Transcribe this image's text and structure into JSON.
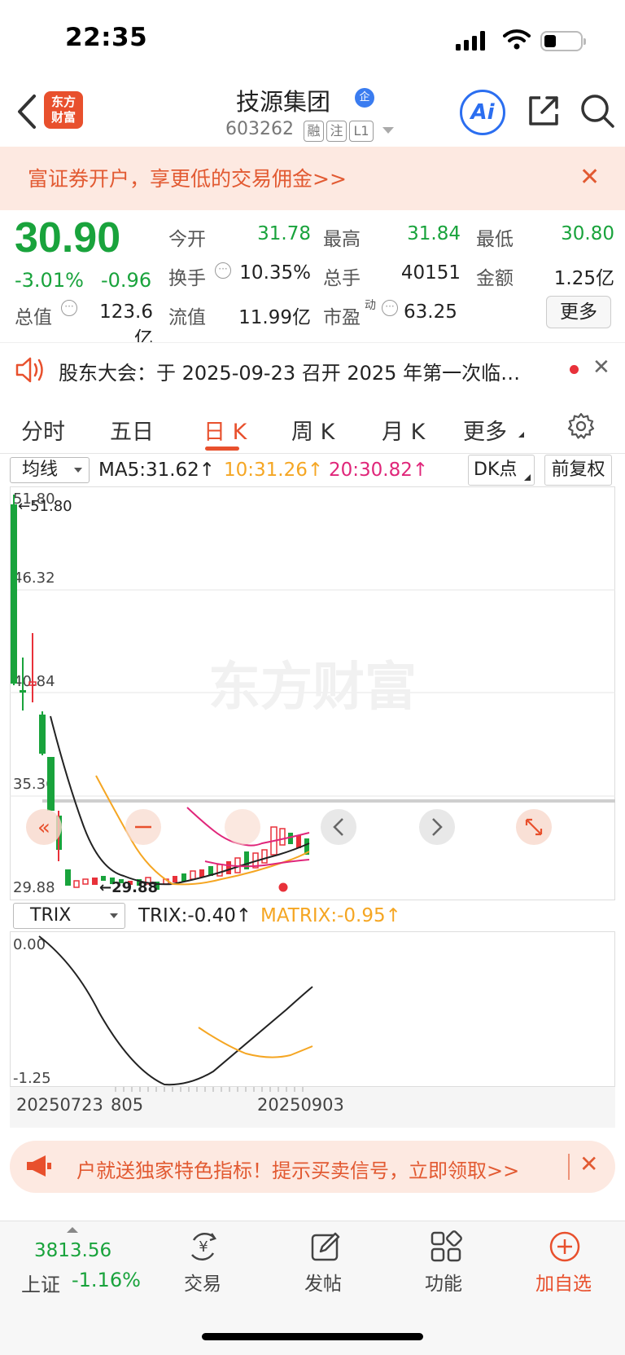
{
  "status": {
    "time": "22:35"
  },
  "header": {
    "logo_line1": "东方",
    "logo_line2": "财富",
    "stock_name": "技源集团",
    "verified": "企",
    "stock_code": "603262",
    "tags": [
      "融",
      "注",
      "L1"
    ],
    "ai_label": "Ai"
  },
  "promo": {
    "text": "富证券开户，享更低的交易佣金>>"
  },
  "quote": {
    "price": "30.90",
    "change_pct": "-3.01%",
    "change_amt": "-0.96",
    "open_label": "今开",
    "open": "31.78",
    "high_label": "最高",
    "high": "31.84",
    "low_label": "最低",
    "low": "30.80",
    "turnover_label": "换手",
    "turnover": "10.35%",
    "volume_label": "总手",
    "volume": "40151",
    "amount_label": "金额",
    "amount": "1.25亿",
    "mktcap_label": "总值",
    "mktcap": "123.6亿",
    "float_label": "流值",
    "float": "11.99亿",
    "pe_label": "市盈",
    "pe_sup": "动",
    "pe": "63.25",
    "more_label": "更多"
  },
  "announcement": {
    "text": "股东大会：于 2025-09-23 召开 2025 年第一次临…"
  },
  "tabs": [
    "分时",
    "五日",
    "日 K",
    "周 K",
    "月 K",
    "更多"
  ],
  "indicators": {
    "ma_select": "均线",
    "ma5": "MA5:31.62↑",
    "ma10": "10:31.26↑",
    "ma20": "20:30.82↑",
    "dk": "DK点",
    "adjust": "前复权",
    "trix_select": "TRIX",
    "trix": "TRIX:-0.40↑",
    "matrix": "MATRIX:-0.95↑"
  },
  "chart_data": [
    {
      "type": "candlestick",
      "y_ticks": [
        "51.80",
        "46.32",
        "40.84",
        "35.36",
        "29.88"
      ],
      "ylim": [
        29.88,
        51.8
      ],
      "high_marker": "←51.80",
      "low_marker": "←29.88",
      "watermark": "东方财富"
    },
    {
      "type": "line",
      "y_ticks": [
        "0.00",
        "-1.25"
      ],
      "ylim": [
        -1.25,
        0.0
      ],
      "x_labels": [
        "20250723",
        "805",
        "20250903"
      ]
    }
  ],
  "promo2": {
    "text": "户就送独家特色指标！提示买卖信号，立即领取>>"
  },
  "bottom": {
    "index_value": "3813.56",
    "index_name": "上证",
    "index_change": "-1.16%",
    "items": [
      "交易",
      "发帖",
      "功能",
      "加自选"
    ]
  },
  "colors": {
    "up": "#e8313a",
    "down": "#19a33c",
    "accent": "#e8502d",
    "ma10": "#f5a623",
    "ma20": "#e0267a"
  }
}
